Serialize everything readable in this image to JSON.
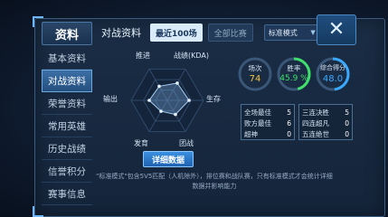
{
  "sidebar": {
    "title": "资料",
    "items": [
      {
        "label": "基本资料",
        "active": false
      },
      {
        "label": "对战资料",
        "active": true
      },
      {
        "label": "荣誉资料",
        "active": false
      },
      {
        "label": "常用英雄",
        "active": false
      },
      {
        "label": "历史战绩",
        "active": false
      },
      {
        "label": "信誉积分",
        "active": false
      },
      {
        "label": "赛事信息",
        "active": false
      }
    ]
  },
  "header": {
    "title": "对战资料",
    "tabs": [
      {
        "label": "最近100场",
        "active": true
      },
      {
        "label": "全部比赛",
        "active": false
      }
    ],
    "mode_select": {
      "value": "标准模式"
    }
  },
  "close_button": {
    "icon": "close-icon"
  },
  "radar": {
    "labels": {
      "push": "推进",
      "kda": "战绩(KDA)",
      "survive": "生存",
      "team": "团战",
      "develop": "发育",
      "output": "输出"
    },
    "values": {
      "push": 0.45,
      "kda": 0.55,
      "survive": 0.6,
      "team": 0.45,
      "develop": 0.35,
      "output": 0.5
    }
  },
  "detail_button": {
    "label": "详细数据"
  },
  "stats": {
    "matches": {
      "label": "场次",
      "value": "74",
      "color": "#f5c23e"
    },
    "winrate": {
      "label": "胜率",
      "value": "45.9 %",
      "color": "#3fe06a",
      "fraction": 0.459
    },
    "score": {
      "label": "综合得分",
      "value": "48.0",
      "color": "#39a9ff",
      "fraction": 0.48
    }
  },
  "stat_box_left": [
    {
      "label": "全场最佳",
      "value": "5"
    },
    {
      "label": "败方最佳",
      "value": "6"
    },
    {
      "label": "超神",
      "value": "0"
    }
  ],
  "stat_box_right": [
    {
      "label": "三连决胜",
      "value": "5"
    },
    {
      "label": "四连超凡",
      "value": "0"
    },
    {
      "label": "五连绝世",
      "value": "0"
    }
  ],
  "footnote": "\"标准模式\"包含5V5匹配（人机除外），排位赛和战队赛，只有标准模式才会统计详细数据并影响能力"
}
